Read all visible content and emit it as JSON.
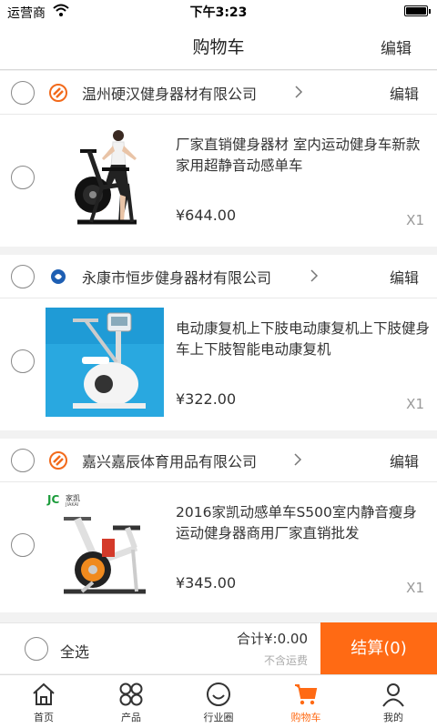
{
  "status": {
    "carrier": "运营商",
    "time": "下午3:23",
    "battery_level": 1.0
  },
  "header": {
    "title": "购物车",
    "edit_label": "编辑"
  },
  "shops": [
    {
      "name": "温州硬汉健身器材有限公司",
      "edit_label": "编辑",
      "logo": "swirl-logo",
      "logo_color": "#f26a1b",
      "item": {
        "title": "厂家直销健身器材 室内运动健身车新款家用超静音动感单车",
        "price": "¥644.00",
        "qty": "X1"
      }
    },
    {
      "name": "永康市恒步健身器材有限公司",
      "edit_label": "编辑",
      "logo": "round-blue-logo",
      "logo_color": "#1e5fb3",
      "item": {
        "title": "电动康复机上下肢电动康复机上下肢健身车上下肢智能电动康复机",
        "price": "¥322.00",
        "qty": "X1"
      }
    },
    {
      "name": "嘉兴嘉辰体育用品有限公司",
      "edit_label": "编辑",
      "logo": "swirl-logo",
      "logo_color": "#f26a1b",
      "item": {
        "title": "2016家凯动感单车S500室内静音瘦身运动健身器商用厂家直销批发",
        "price": "¥345.00",
        "qty": "X1",
        "brand_text": "JC",
        "brand_cn": "家凯",
        "brand_en": "JIAKAI"
      }
    }
  ],
  "checkout": {
    "select_all_label": "全选",
    "total_label": "合计¥:0.00",
    "shipping_note": "不含运费",
    "button_label": "结算(0)",
    "accent_color": "#ff6a14"
  },
  "tabs": [
    {
      "label": "首页",
      "icon": "home-icon"
    },
    {
      "label": "产品",
      "icon": "grid-icon"
    },
    {
      "label": "行业圈",
      "icon": "smile-icon"
    },
    {
      "label": "购物车",
      "icon": "cart-icon",
      "active": true
    },
    {
      "label": "我的",
      "icon": "person-icon"
    }
  ]
}
